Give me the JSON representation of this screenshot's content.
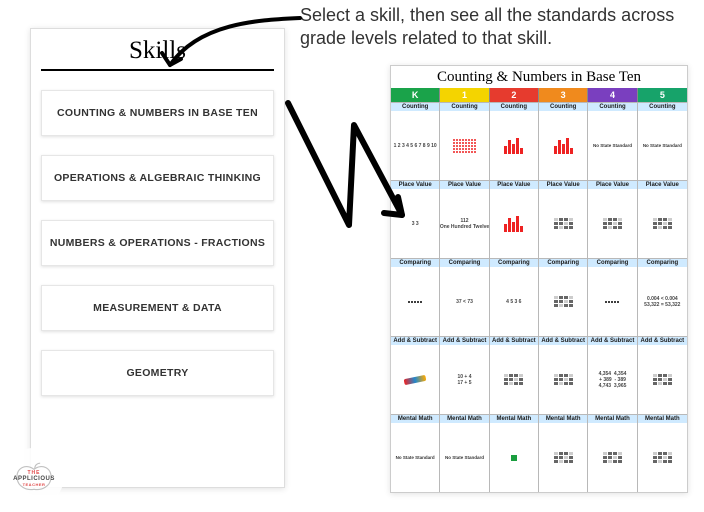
{
  "caption": "Select a skill, then see all the standards across grade levels related to that skill.",
  "skills": {
    "title": "Skills",
    "items": [
      "COUNTING & NUMBERS IN BASE TEN",
      "OPERATIONS & ALGEBRAIC THINKING",
      "NUMBERS & OPERATIONS - FRACTIONS",
      "MEASUREMENT & DATA",
      "GEOMETRY"
    ]
  },
  "grid": {
    "title": "Counting & Numbers in Base Ten",
    "grades": [
      {
        "label": "K",
        "color": "#1aa34a"
      },
      {
        "label": "1",
        "color": "#f4d400"
      },
      {
        "label": "2",
        "color": "#e63b2e"
      },
      {
        "label": "3",
        "color": "#f08a1d"
      },
      {
        "label": "4",
        "color": "#7a3fbf"
      },
      {
        "label": "5",
        "color": "#17a36a"
      }
    ],
    "categories": [
      "Counting",
      "Place Value",
      "Comparing",
      "Add & Subtract",
      "Mental Math"
    ],
    "category_tints": [
      "#cfeaff",
      "#cfeaff",
      "#cfeaff",
      "#cfeaff",
      "#cfeaff"
    ],
    "rows": [
      [
        {
          "type": "text",
          "text": "1 2 3 4 5 6 7 8 9 10"
        },
        {
          "type": "dotgrid"
        },
        {
          "type": "bars"
        },
        {
          "type": "bars"
        },
        {
          "type": "nostd"
        },
        {
          "type": "nostd"
        }
      ],
      [
        {
          "type": "text",
          "text": "3 3"
        },
        {
          "type": "text",
          "text": "112\\nOne Hundred Twelve"
        },
        {
          "type": "bars"
        },
        {
          "type": "minigrid"
        },
        {
          "type": "minigrid"
        },
        {
          "type": "minigrid"
        }
      ],
      [
        {
          "type": "dotrow"
        },
        {
          "type": "text",
          "text": "37 < 73"
        },
        {
          "type": "text",
          "text": "4 5 3 6"
        },
        {
          "type": "minigrid"
        },
        {
          "type": "dotrow"
        },
        {
          "type": "text",
          "text": "0.004 < 0.004\\n53,322 = 53,322"
        }
      ],
      [
        {
          "type": "img"
        },
        {
          "type": "text",
          "text": "10 + 4\\n17 + 5"
        },
        {
          "type": "minigrid"
        },
        {
          "type": "minigrid"
        },
        {
          "type": "text",
          "text": "4,354  4,354\\n+ 389  - 389\\n4,743  3,965"
        },
        {
          "type": "minigrid"
        }
      ],
      [
        {
          "type": "nostd"
        },
        {
          "type": "nostd"
        },
        {
          "type": "tinygreen"
        },
        {
          "type": "minigrid"
        },
        {
          "type": "minigrid"
        },
        {
          "type": "minigrid"
        }
      ]
    ],
    "nostd_text": "No State Standard"
  },
  "logo": {
    "l1": "THE",
    "l2": "APPLICIOUS",
    "l3": "TEACHER"
  }
}
